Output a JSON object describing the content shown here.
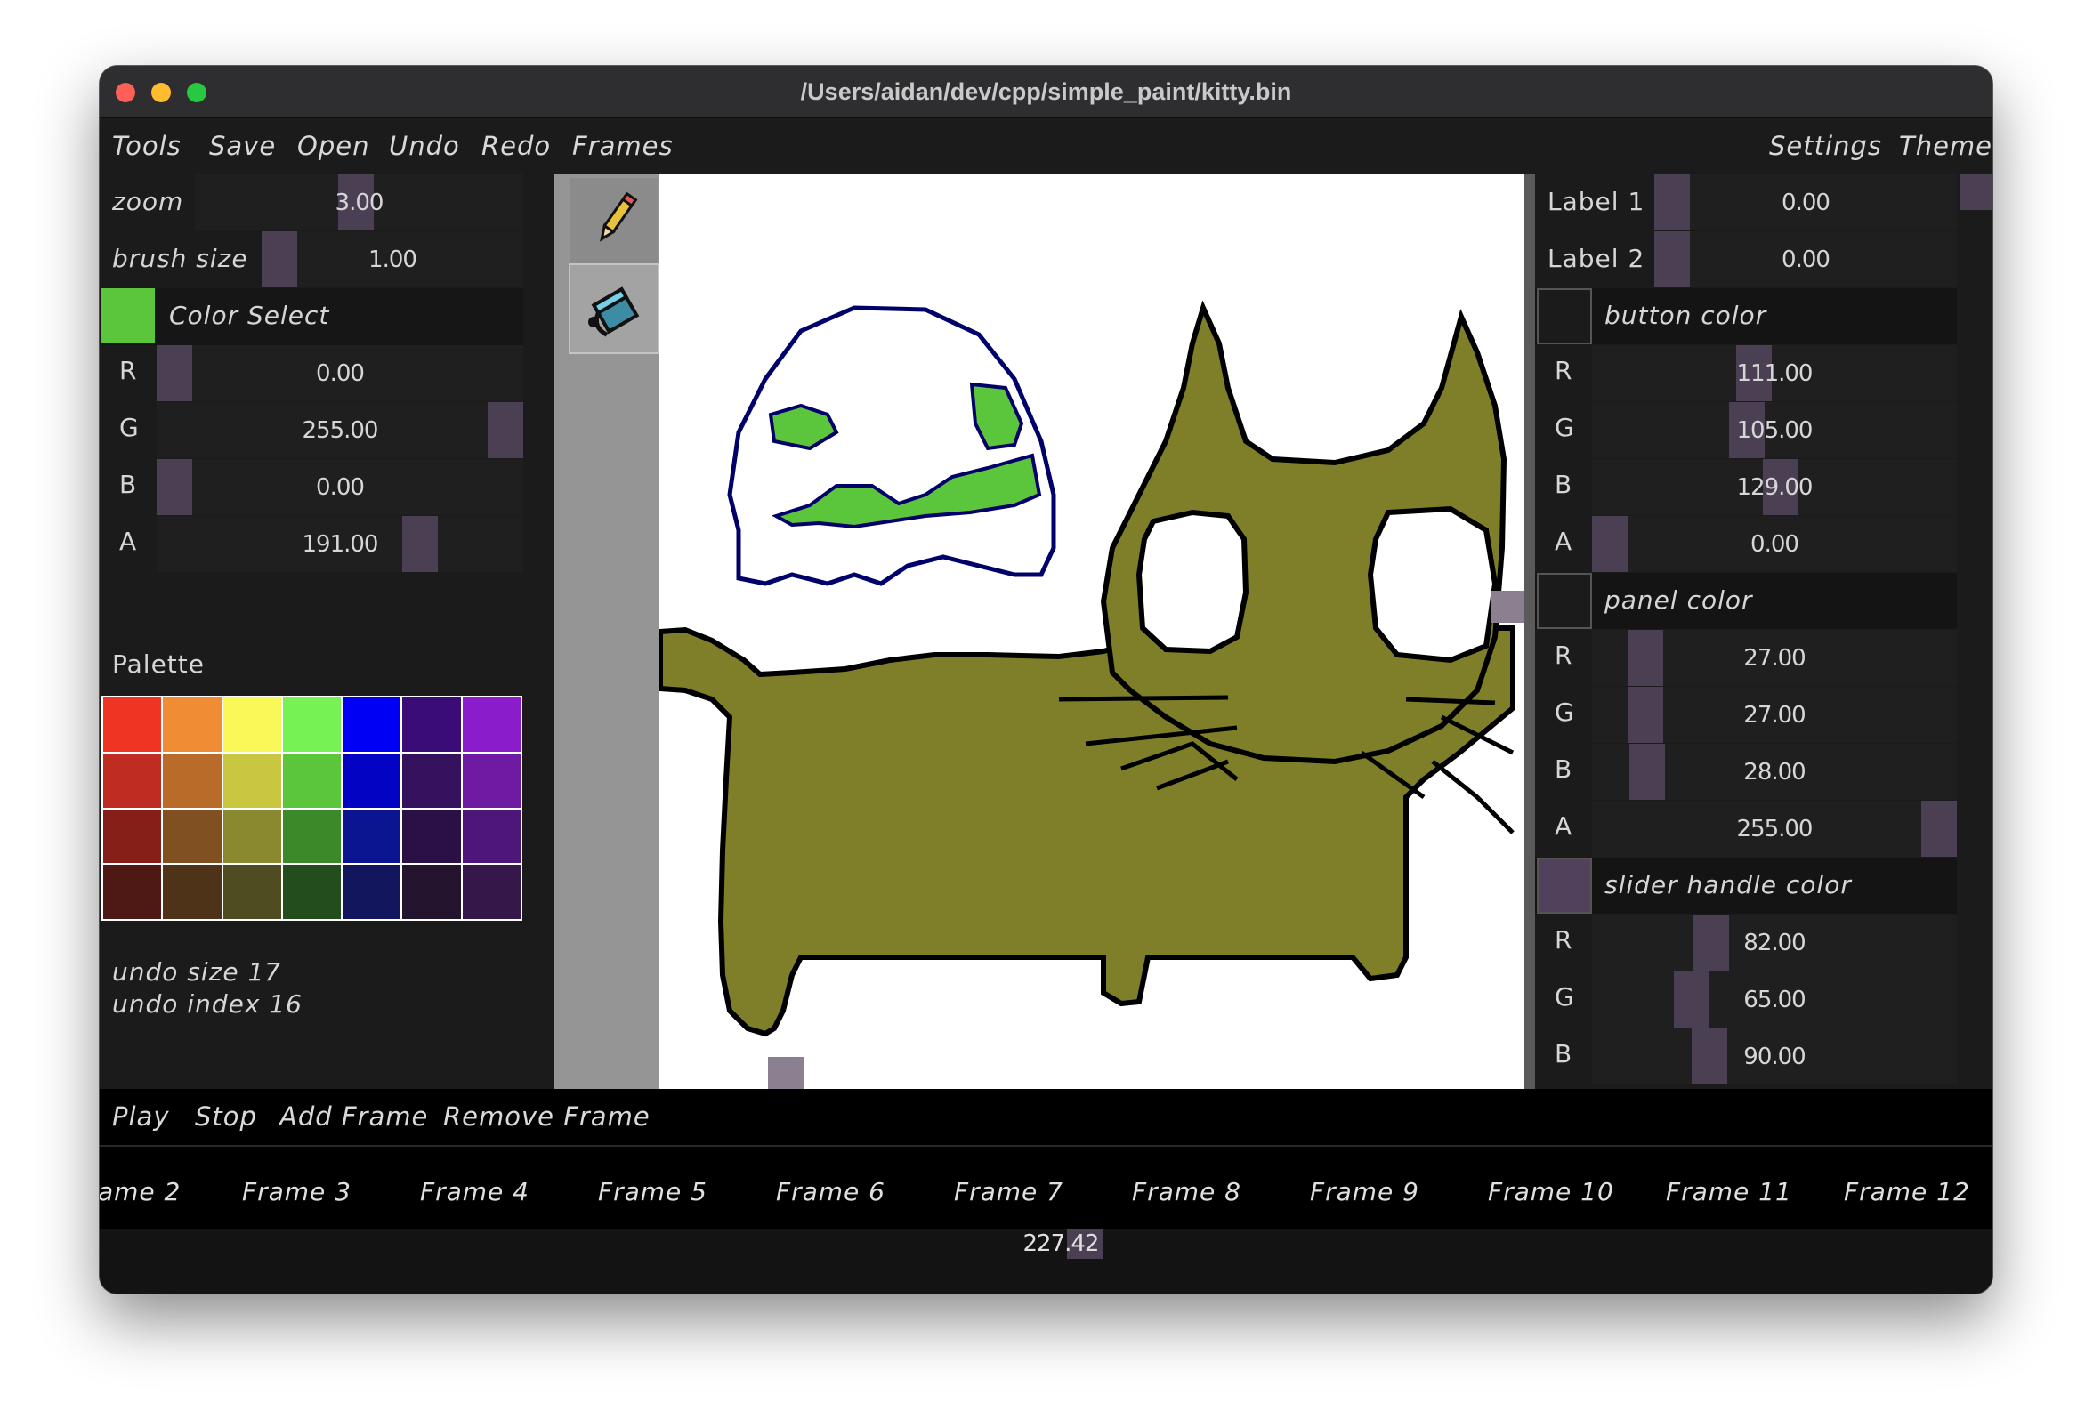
{
  "window": {
    "title": "/Users/aidan/dev/cpp/simple_paint/kitty.bin"
  },
  "menu": {
    "tools": "Tools",
    "save": "Save",
    "open": "Open",
    "undo": "Undo",
    "redo": "Redo",
    "frames": "Frames",
    "settings": "Settings",
    "theme": "Theme"
  },
  "left_panel": {
    "zoom": {
      "label": "zoom",
      "value": "3.00"
    },
    "brush_size": {
      "label": "brush size",
      "value": "1.00"
    },
    "color_select": {
      "label": "Color Select",
      "swatch_color": "#5bc53b"
    },
    "channels": [
      {
        "label": "R",
        "value": "0.00"
      },
      {
        "label": "G",
        "value": "255.00"
      },
      {
        "label": "B",
        "value": "0.00"
      },
      {
        "label": "A",
        "value": "191.00"
      }
    ],
    "palette_label": "Palette",
    "palette": [
      "#ee3524",
      "#f08c34",
      "#f8f858",
      "#77f255",
      "#0000f5",
      "#3a0c78",
      "#8b1ccc",
      "#be2c22",
      "#b96b2a",
      "#c9c640",
      "#5bc53b",
      "#0303c4",
      "#36115e",
      "#6e1aa3",
      "#851f17",
      "#805020",
      "#8a8930",
      "#3b8a2a",
      "#0b1591",
      "#2a1045",
      "#4e1678",
      "#4e1814",
      "#4f3319",
      "#4e4c20",
      "#244d1e",
      "#12175d",
      "#24142e",
      "#351849"
    ],
    "undo_size": "undo size 17",
    "undo_index": "undo index 16"
  },
  "tools": [
    {
      "name": "pencil-icon"
    },
    {
      "name": "bucket-icon"
    }
  ],
  "right_panel": {
    "label1": {
      "label": "Label 1",
      "value": "0.00"
    },
    "label2": {
      "label": "Label 2",
      "value": "0.00"
    },
    "button_color": {
      "label": "button color",
      "swatch": "#1b1b1c",
      "channels": [
        {
          "label": "R",
          "value": "111.00"
        },
        {
          "label": "G",
          "value": "105.00"
        },
        {
          "label": "B",
          "value": "129.00"
        },
        {
          "label": "A",
          "value": "0.00"
        }
      ]
    },
    "panel_color": {
      "label": "panel color",
      "swatch": "#1b1b1c",
      "channels": [
        {
          "label": "R",
          "value": "27.00"
        },
        {
          "label": "G",
          "value": "27.00"
        },
        {
          "label": "B",
          "value": "28.00"
        },
        {
          "label": "A",
          "value": "255.00"
        }
      ]
    },
    "slider_handle_color": {
      "label": "slider handle color",
      "swatch": "#52415a",
      "channels": [
        {
          "label": "R",
          "value": "82.00"
        },
        {
          "label": "G",
          "value": "65.00"
        },
        {
          "label": "B",
          "value": "90.00"
        }
      ]
    }
  },
  "bottom_bar": {
    "play": "Play",
    "stop": "Stop",
    "add_frame": "Add Frame",
    "remove_frame": "Remove Frame"
  },
  "frames": [
    "ame 2",
    "Frame 3",
    "Frame 4",
    "Frame 5",
    "Frame 6",
    "Frame 7",
    "Frame 8",
    "Frame 9",
    "Frame 10",
    "Frame 11",
    "Frame 12"
  ],
  "scrubber": {
    "value": "227.42"
  },
  "colors": {
    "cat": "#7f7f2a",
    "ghost_outline": "#00006b",
    "ghost_fill": "#5bc53b",
    "handle": "#4b3f53"
  }
}
